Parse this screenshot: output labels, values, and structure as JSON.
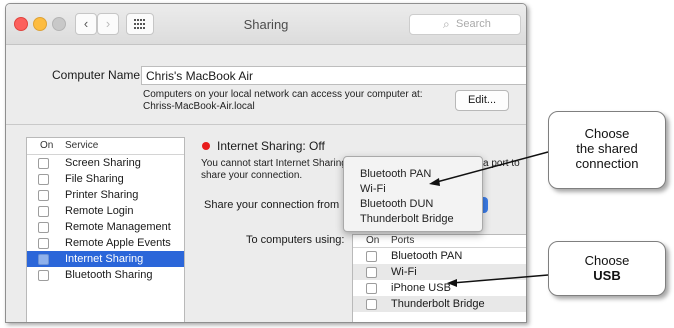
{
  "window": {
    "title": "Sharing",
    "search_placeholder": "Search",
    "back_glyph": "‹",
    "forward_glyph": "›"
  },
  "computer_name": {
    "label": "Computer Name:",
    "value": "Chris's MacBook Air",
    "description_line1": "Computers on your local network can access your computer at:",
    "description_line2": "Chriss-MacBook-Air.local",
    "edit_button": "Edit..."
  },
  "services": {
    "header_on": "On",
    "header_service": "Service",
    "items": [
      {
        "label": "Screen Sharing",
        "checked": false,
        "selected": false
      },
      {
        "label": "File Sharing",
        "checked": false,
        "selected": false
      },
      {
        "label": "Printer Sharing",
        "checked": false,
        "selected": false
      },
      {
        "label": "Remote Login",
        "checked": false,
        "selected": false
      },
      {
        "label": "Remote Management",
        "checked": false,
        "selected": false
      },
      {
        "label": "Remote Apple Events",
        "checked": false,
        "selected": false
      },
      {
        "label": "Internet Sharing",
        "checked": false,
        "selected": true
      },
      {
        "label": "Bluetooth Sharing",
        "checked": false,
        "selected": false
      }
    ]
  },
  "detail": {
    "status": "Internet Sharing: Off",
    "status_color": "#e81c1c",
    "message_line1_left": "You cannot start Internet Sharing",
    "message_line1_right": "a port to",
    "message_line2": "share your connection.",
    "share_from_label": "Share your connection from",
    "to_computers_label": "To computers using:"
  },
  "popup_menu": {
    "items": [
      "Bluetooth PAN",
      "Wi-Fi",
      "Bluetooth DUN",
      "Thunderbolt Bridge"
    ]
  },
  "ports": {
    "header_on": "On",
    "header_ports": "Ports",
    "items": [
      {
        "label": "Bluetooth PAN",
        "checked": false
      },
      {
        "label": "Wi-Fi",
        "checked": false
      },
      {
        "label": "iPhone USB",
        "checked": false
      },
      {
        "label": "Thunderbolt Bridge",
        "checked": false
      }
    ]
  },
  "callouts": {
    "top": {
      "line1": "Choose",
      "line2": "the shared",
      "line3": "connection"
    },
    "bottom": {
      "line1": "Choose",
      "line2": "USB"
    }
  }
}
